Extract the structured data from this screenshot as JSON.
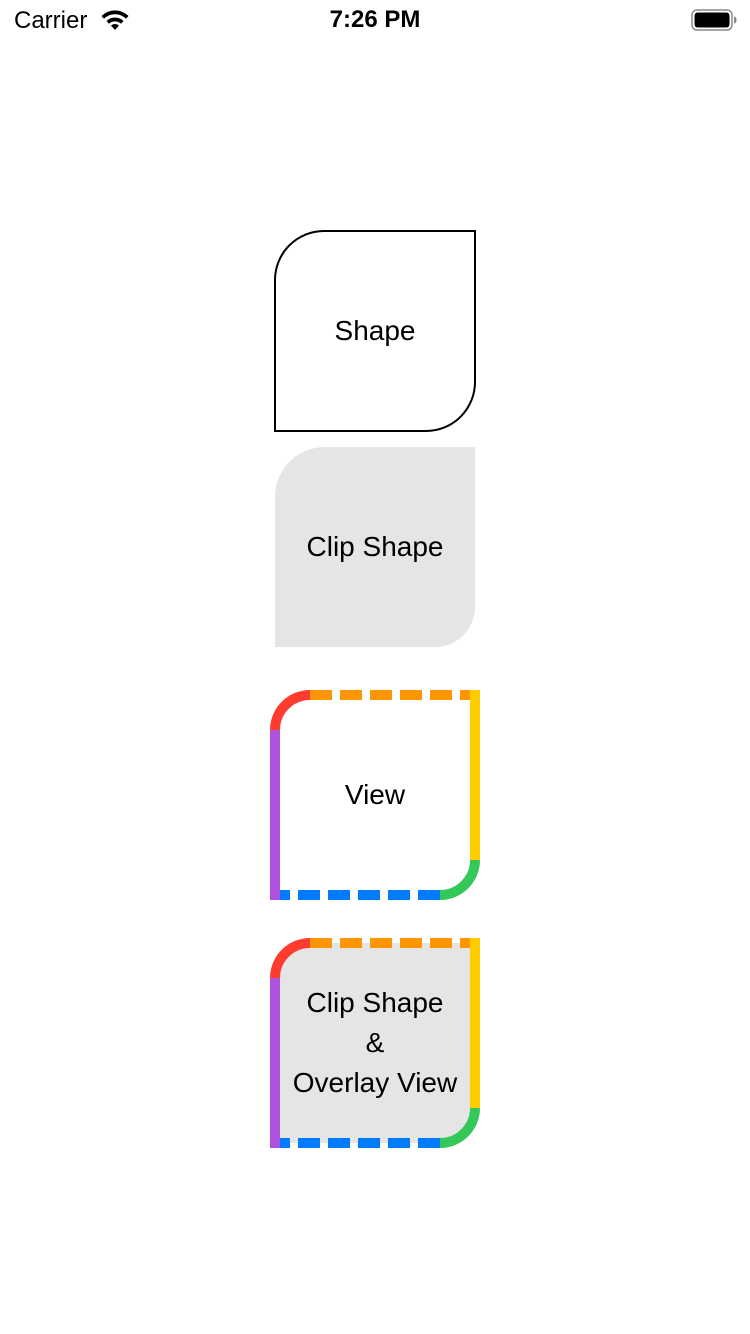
{
  "status_bar": {
    "carrier": "Carrier",
    "time": "7:26 PM",
    "icons": [
      "wifi-icon",
      "battery-icon"
    ]
  },
  "shapes": {
    "shape_label": "Shape",
    "clip_shape_label": "Clip Shape",
    "view_label": "View",
    "overlay_label_lines": [
      "Clip Shape",
      "&",
      "Overlay View"
    ]
  },
  "colors": {
    "clip_fill": "#e5e5e5",
    "top_left_corner": "#ff3b30",
    "top_edge": "#ff9500",
    "right_edge": "#ffcc00",
    "bottom_right_corner": "#34c759",
    "bottom_edge": "#007aff",
    "left_edge": "#af52de"
  }
}
